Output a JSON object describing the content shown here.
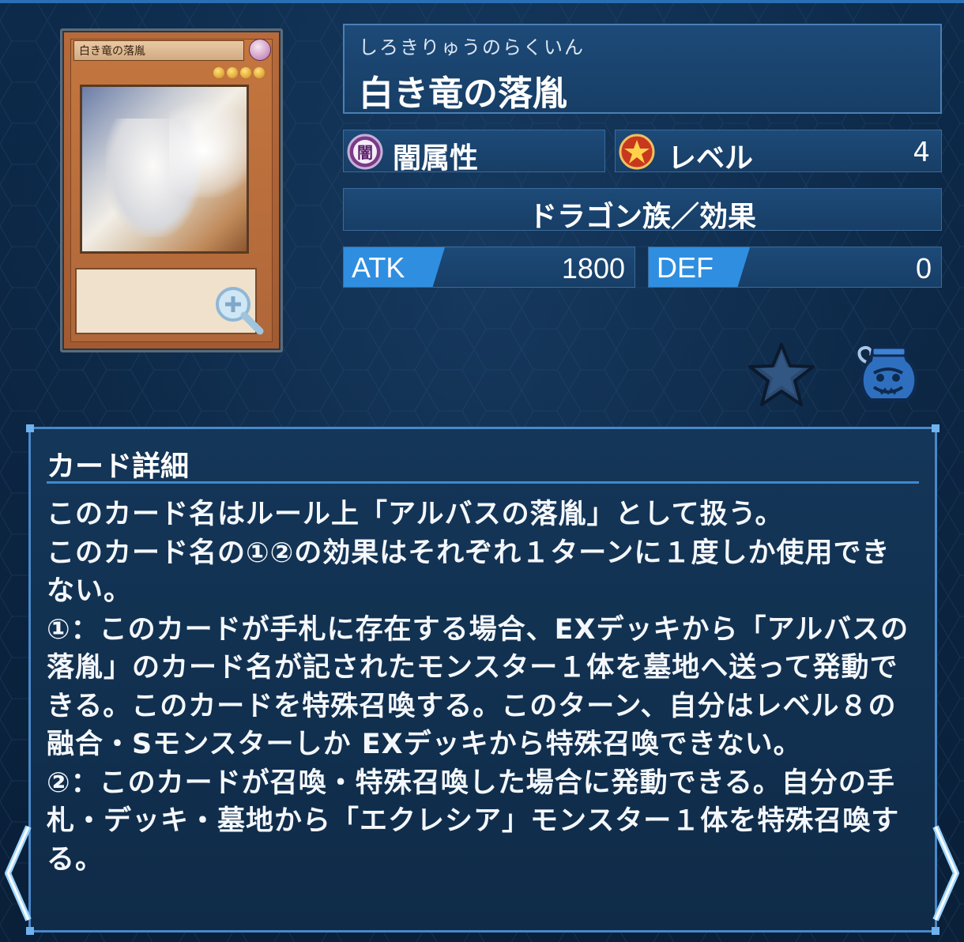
{
  "card": {
    "reading": "しろきりゅうのらくいん",
    "name": "白き竜の落胤",
    "attribute_label": "闇属性",
    "attribute_icon_char": "闇",
    "level_label": "レベル",
    "level_value": "4",
    "type_line": "ドラゴン族／効果",
    "atk_label": "ATK",
    "atk_value": "1800",
    "def_label": "DEF",
    "def_value": "0",
    "image_name": "白き竜の落胤",
    "image_stars": 4
  },
  "detail": {
    "title": "カード詳細",
    "text": "このカード名はルール上「アルバスの落胤」として扱う。\nこのカード名の①②の効果はそれぞれ１ターンに１度しか使用できない。\n①：このカードが手札に存在する場合、EXデッキから「アルバスの落胤」のカード名が記されたモンスター１体を墓地へ送って発動できる。このカードを特殊召喚する。このターン、自分はレベル８の融合・Sモンスターしか EXデッキから特殊召喚できない。\n②：このカードが召喚・特殊召喚した場合に発動できる。自分の手札・デッキ・墓地から「エクレシア」モンスター１体を特殊召喚する。"
  },
  "icons": {
    "zoom": "magnifier-plus-icon",
    "favorite": "star-icon",
    "pot": "pot-of-greed-icon",
    "prev": "chevron-left-icon",
    "next": "chevron-right-icon"
  },
  "colors": {
    "background": "#0b2440",
    "panel": "#1d4a78",
    "accent": "#2f8ee0",
    "border": "#4a88c8"
  }
}
